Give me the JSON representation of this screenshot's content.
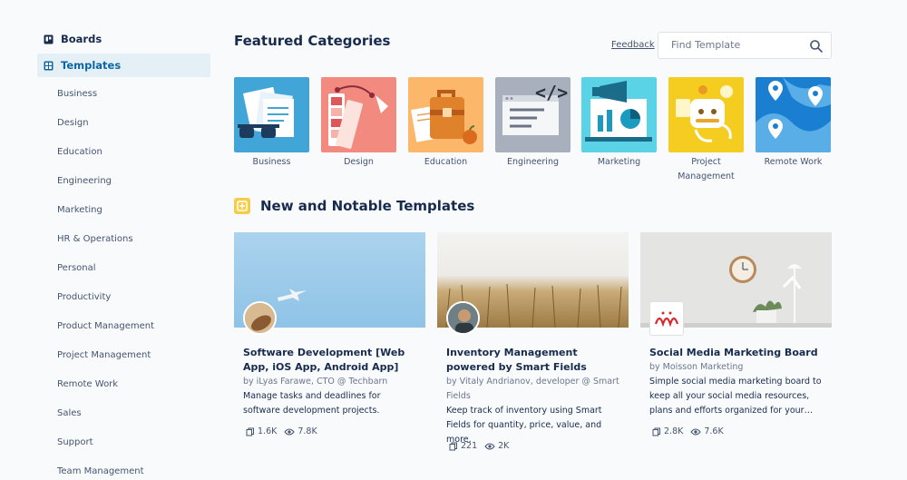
{
  "sidebar": {
    "boards_label": "Boards",
    "templates_label": "Templates",
    "categories": [
      "Business",
      "Design",
      "Education",
      "Engineering",
      "Marketing",
      "HR & Operations",
      "Personal",
      "Productivity",
      "Product Management",
      "Project Management",
      "Remote Work",
      "Sales",
      "Support",
      "Team Management"
    ]
  },
  "header": {
    "title": "Featured Categories",
    "feedback_label": "Feedback",
    "search_placeholder": "Find Template"
  },
  "featured": [
    {
      "label": "Business",
      "color": "#42a5d8"
    },
    {
      "label": "Design",
      "color": "#f38a7f"
    },
    {
      "label": "Education",
      "color": "#fcb76a"
    },
    {
      "label": "Engineering",
      "color": "#a9b0bd"
    },
    {
      "label": "Marketing",
      "color": "#5bd3e6"
    },
    {
      "label": "Project Management",
      "color": "#f5cd20"
    },
    {
      "label": "Remote Work",
      "color": "#1a7fd0"
    }
  ],
  "notable": {
    "title": "New and Notable Templates",
    "cards": [
      {
        "title": "Software Development [Web App, iOS App, Android App]",
        "author": "by iLyas Farawe, CTO @ Techbarn",
        "description": "Manage tasks and deadlines for software development projects.",
        "copies": "1.6K",
        "views": "7.8K"
      },
      {
        "title": "Inventory Management powered by Smart Fields",
        "author": "by Vitaly Andrianov, developer @ Smart Fields",
        "description": "Keep track of inventory using Smart Fields for quantity, price, value, and more.",
        "copies": "221",
        "views": "2K"
      },
      {
        "title": "Social Media Marketing Board",
        "author": "by Moisson Marketing",
        "description": "Simple social media marketing board to keep all your social media resources, plans and efforts organized for your…",
        "copies": "2.8K",
        "views": "7.6K"
      }
    ]
  }
}
